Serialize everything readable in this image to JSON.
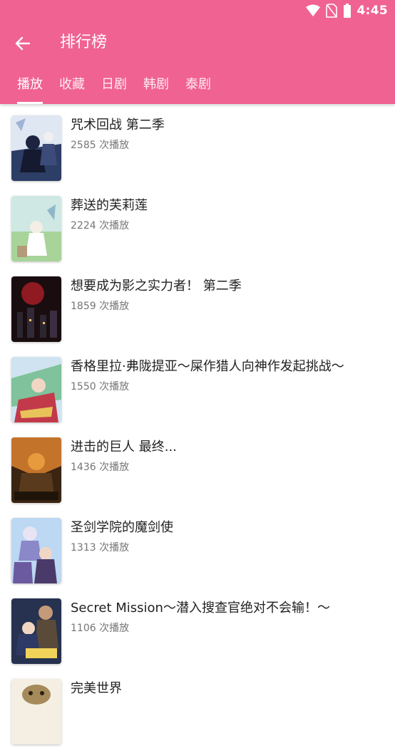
{
  "status": {
    "time": "4:45"
  },
  "toolbar": {
    "title": "排行榜",
    "back_icon": "arrow-left-icon"
  },
  "tabs": [
    {
      "label": "播放",
      "active": true
    },
    {
      "label": "收藏",
      "active": false
    },
    {
      "label": "日剧",
      "active": false
    },
    {
      "label": "韩剧",
      "active": false
    },
    {
      "label": "泰剧",
      "active": false
    }
  ],
  "items": [
    {
      "title": "咒术回战 第二季",
      "plays": "2585 次播放"
    },
    {
      "title": "葬送的芙莉莲",
      "plays": "2224 次播放"
    },
    {
      "title": "想要成为影之实力者！ 第二季",
      "plays": "1859 次播放"
    },
    {
      "title": "香格里拉·弗陇提亚～屎作猎人向神作发起挑战～",
      "plays": "1550 次播放"
    },
    {
      "title": "进击的巨人 最终...",
      "plays": "1436 次播放"
    },
    {
      "title": "圣剑学院的魔剑使",
      "plays": "1313 次播放"
    },
    {
      "title": "Secret Mission～潜入搜查官绝对不会输！～",
      "plays": "1106 次播放"
    },
    {
      "title": "完美世界",
      "plays": ""
    }
  ],
  "colors": {
    "primary": "#f06292",
    "title_text": "#212121",
    "sub_text": "#757575"
  }
}
